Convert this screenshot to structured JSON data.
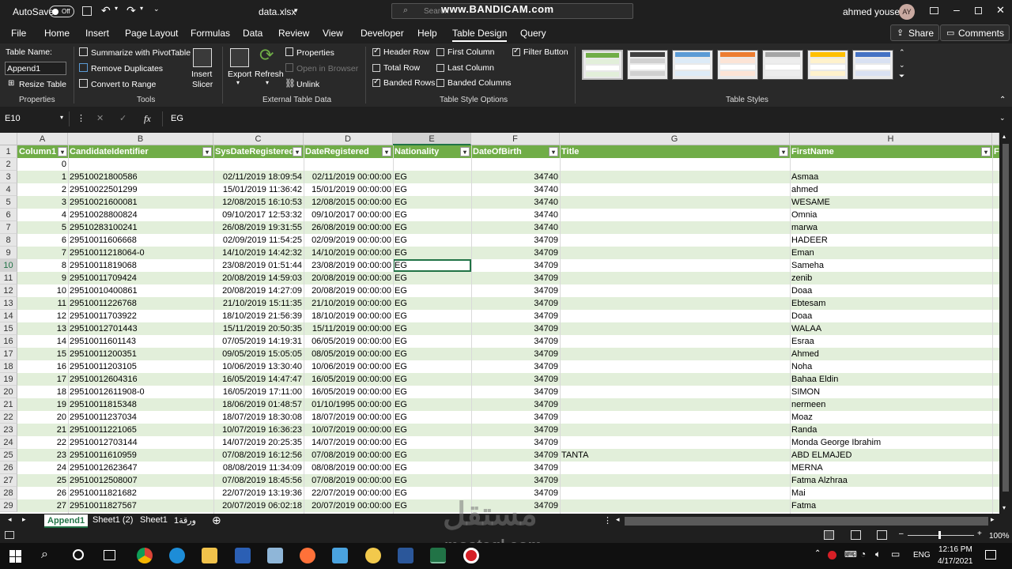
{
  "titlebar": {
    "autosave_label": "AutoSave",
    "autosave_state": "Off",
    "file_name": "data.xlsx",
    "search_placeholder": "Search",
    "recorder_watermark": "www.BANDICAM.com",
    "user_name": "ahmed yousef",
    "user_initials": "AY"
  },
  "menu": {
    "items": [
      "File",
      "Home",
      "Insert",
      "Page Layout",
      "Formulas",
      "Data",
      "Review",
      "View",
      "Developer",
      "Help",
      "Table Design",
      "Query"
    ],
    "active": "Table Design",
    "share_label": "Share",
    "comments_label": "Comments"
  },
  "ribbon": {
    "properties": {
      "table_name_label": "Table Name:",
      "table_name_value": "Append1",
      "resize_label": "Resize Table",
      "group_label": "Properties"
    },
    "tools": {
      "summarize": "Summarize with PivotTable",
      "remove_dup": "Remove Duplicates",
      "convert": "Convert to Range",
      "insert_slicer_1": "Insert",
      "insert_slicer_2": "Slicer",
      "group_label": "Tools"
    },
    "external": {
      "export": "Export",
      "refresh": "Refresh",
      "properties": "Properties",
      "open_browser": "Open in Browser",
      "unlink": "Unlink",
      "group_label": "External Table Data"
    },
    "style_options": {
      "header_row": "Header Row",
      "total_row": "Total Row",
      "banded_rows": "Banded Rows",
      "first_column": "First Column",
      "last_column": "Last Column",
      "banded_columns": "Banded Columns",
      "filter_button": "Filter Button",
      "group_label": "Table Style Options"
    },
    "table_styles": {
      "group_label": "Table Styles",
      "swatch_colors": [
        "#70ad47",
        "#404040",
        "#5b9bd5",
        "#ed7d31",
        "#a5a5a5",
        "#ffc000",
        "#4472c4"
      ]
    }
  },
  "formula_bar": {
    "name_box": "E10",
    "fx": "fx",
    "content": "EG"
  },
  "columns": [
    "A",
    "B",
    "C",
    "D",
    "E",
    "F",
    "G",
    "H"
  ],
  "headers": [
    "Column1",
    "CandidateIdentifier",
    "SysDateRegistered",
    "DateRegistered",
    "Nationality",
    "DateOfBirth",
    "Title",
    "FirstName",
    "Fi"
  ],
  "row_numbers": [
    "1",
    "2",
    "3",
    "4",
    "5",
    "6",
    "7",
    "8",
    "9",
    "10",
    "11",
    "12",
    "13",
    "14",
    "15",
    "16",
    "17",
    "18",
    "19",
    "20",
    "21",
    "22",
    "23",
    "24",
    "25",
    "26",
    "27",
    "28",
    "29"
  ],
  "rows": [
    [
      "0",
      "",
      "",
      "",
      "",
      "",
      "",
      ""
    ],
    [
      "1",
      "29510021800586",
      "02/11/2019 18:09:54",
      "02/11/2019 00:00:00",
      "EG",
      "34740",
      "",
      "Asmaa"
    ],
    [
      "2",
      "29510022501299",
      "15/01/2019 11:36:42",
      "15/01/2019 00:00:00",
      "EG",
      "34740",
      "",
      "ahmed"
    ],
    [
      "3",
      "29510021600081",
      "12/08/2015 16:10:53",
      "12/08/2015 00:00:00",
      "EG",
      "34740",
      "",
      "WESAME"
    ],
    [
      "4",
      "29510028800824",
      "09/10/2017 12:53:32",
      "09/10/2017 00:00:00",
      "EG",
      "34740",
      "",
      "Omnia"
    ],
    [
      "5",
      "29510283100241",
      "26/08/2019 19:31:55",
      "26/08/2019 00:00:00",
      "EG",
      "34740",
      "",
      "marwa"
    ],
    [
      "6",
      "29510011606668",
      "02/09/2019 11:54:25",
      "02/09/2019 00:00:00",
      "EG",
      "34709",
      "",
      "HADEER"
    ],
    [
      "7",
      "29510011218064-0",
      "14/10/2019 14:42:32",
      "14/10/2019 00:00:00",
      "EG",
      "34709",
      "",
      "Eman"
    ],
    [
      "8",
      "29510011819068",
      "23/08/2019 01:51:44",
      "23/08/2019 00:00:00",
      "EG",
      "34709",
      "",
      "Sameha"
    ],
    [
      "9",
      "29510011709424",
      "20/08/2019 14:59:03",
      "20/08/2019 00:00:00",
      "EG",
      "34709",
      "",
      "zenib"
    ],
    [
      "10",
      "29510010400861",
      "20/08/2019 14:27:09",
      "20/08/2019 00:00:00",
      "EG",
      "34709",
      "",
      "Doaa"
    ],
    [
      "11",
      "29510011226768",
      "21/10/2019 15:11:35",
      "21/10/2019 00:00:00",
      "EG",
      "34709",
      "",
      "Ebtesam"
    ],
    [
      "12",
      "29510011703922",
      "18/10/2019 21:56:39",
      "18/10/2019 00:00:00",
      "EG",
      "34709",
      "",
      "Doaa"
    ],
    [
      "13",
      "29510012701443",
      "15/11/2019 20:50:35",
      "15/11/2019 00:00:00",
      "EG",
      "34709",
      "",
      "WALAA"
    ],
    [
      "14",
      "29510011601143",
      "07/05/2019 14:19:31",
      "06/05/2019 00:00:00",
      "EG",
      "34709",
      "",
      "Esraa"
    ],
    [
      "15",
      "29510011200351",
      "09/05/2019 15:05:05",
      "08/05/2019 00:00:00",
      "EG",
      "34709",
      "",
      "Ahmed"
    ],
    [
      "16",
      "29510011203105",
      "10/06/2019 13:30:40",
      "10/06/2019 00:00:00",
      "EG",
      "34709",
      "",
      "Noha"
    ],
    [
      "17",
      "29510012604316",
      "16/05/2019 14:47:47",
      "16/05/2019 00:00:00",
      "EG",
      "34709",
      "",
      "Bahaa Eldin"
    ],
    [
      "18",
      "29510012611908-0",
      "16/05/2019 17:11:00",
      "16/05/2019 00:00:00",
      "EG",
      "34709",
      "",
      "SIMON"
    ],
    [
      "19",
      "29510011815348",
      "18/06/2019 01:48:57",
      "01/10/1995 00:00:00",
      "EG",
      "34709",
      "",
      "nermeen"
    ],
    [
      "20",
      "29510011237034",
      "18/07/2019 18:30:08",
      "18/07/2019 00:00:00",
      "EG",
      "34709",
      "",
      "Moaz"
    ],
    [
      "21",
      "29510011221065",
      "10/07/2019 16:36:23",
      "10/07/2019 00:00:00",
      "EG",
      "34709",
      "",
      "Randa"
    ],
    [
      "22",
      "29510012703144",
      "14/07/2019 20:25:35",
      "14/07/2019 00:00:00",
      "EG",
      "34709",
      "",
      "Monda George Ibrahim"
    ],
    [
      "23",
      "29510011610959",
      "07/08/2019 16:12:56",
      "07/08/2019 00:00:00",
      "EG",
      "34709",
      "TANTA",
      "ABD ELMAJED"
    ],
    [
      "24",
      "29510012623647",
      "08/08/2019 11:34:09",
      "08/08/2019 00:00:00",
      "EG",
      "34709",
      "",
      "MERNA"
    ],
    [
      "25",
      "29510012508007",
      "07/08/2019 18:45:56",
      "07/08/2019 00:00:00",
      "EG",
      "34709",
      "",
      "Fatma Alzhraa"
    ],
    [
      "26",
      "29510011821682",
      "22/07/2019 13:19:36",
      "22/07/2019 00:00:00",
      "EG",
      "34709",
      "",
      "Mai"
    ],
    [
      "27",
      "29510011827567",
      "20/07/2019 06:02:18",
      "20/07/2019 00:00:00",
      "EG",
      "34709",
      "",
      "Fatma"
    ]
  ],
  "sheets": [
    "Append1",
    "Sheet1 (2)",
    "Sheet1",
    "ورقة1"
  ],
  "active_sheet": "Append1",
  "status": {
    "zoom": "100%"
  },
  "taskbar": {
    "language": "ENG",
    "time": "12:16 PM",
    "date": "4/17/2021"
  },
  "overlay_watermark": {
    "arabic": "مستقل",
    "latin": "mostaql.com"
  }
}
